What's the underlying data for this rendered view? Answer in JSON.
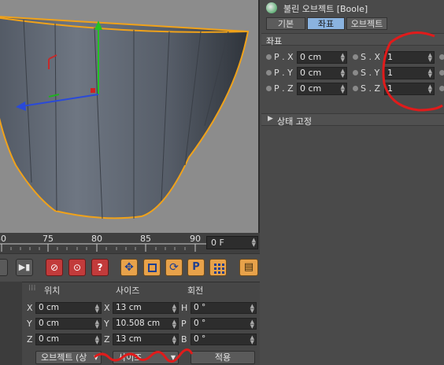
{
  "panel": {
    "title": "불린 오브젝트 [Boole]",
    "tabs": [
      "기본",
      "좌표",
      "오브젝트"
    ],
    "section": "좌표",
    "rows": [
      {
        "p_label": "P . X",
        "p_value": "0 cm",
        "s_label": "S . X",
        "s_value": "1"
      },
      {
        "p_label": "P . Y",
        "p_value": "0 cm",
        "s_label": "S . Y",
        "s_value": "1"
      },
      {
        "p_label": "P . Z",
        "p_value": "0 cm",
        "s_label": "S . Z",
        "s_value": "1"
      }
    ],
    "freeze": "상태 고정"
  },
  "timeline": {
    "ticks": [
      "80",
      "75",
      "80",
      "85",
      "90"
    ],
    "frame": "0 F"
  },
  "coord": {
    "headers": {
      "position": "위치",
      "size": "사이즈",
      "rotation": "회전"
    },
    "rows": [
      {
        "pos_label": "X",
        "pos": "0 cm",
        "size_label": "X",
        "size": "13 cm",
        "rot_label": "H",
        "rot": "0 °"
      },
      {
        "pos_label": "Y",
        "pos": "0 cm",
        "size_label": "Y",
        "size": "10.508 cm",
        "rot_label": "P",
        "rot": "0 °"
      },
      {
        "pos_label": "Z",
        "pos": "0 cm",
        "size_label": "Z",
        "size": "13 cm",
        "rot_label": "B",
        "rot": "0 °"
      }
    ],
    "mode_select": "오브젝트 (상",
    "size_select": "사이즈",
    "apply": "적용"
  },
  "colors": {
    "annotation": "#e01b1b",
    "active_tab": "#8ab3e0",
    "object_outline": "#f0a21a"
  },
  "icons": [
    "record-icon",
    "keyframe-icon",
    "help-icon",
    "move-icon",
    "scale-icon",
    "rotate-icon",
    "p-icon",
    "grid-icon",
    "film-icon"
  ]
}
